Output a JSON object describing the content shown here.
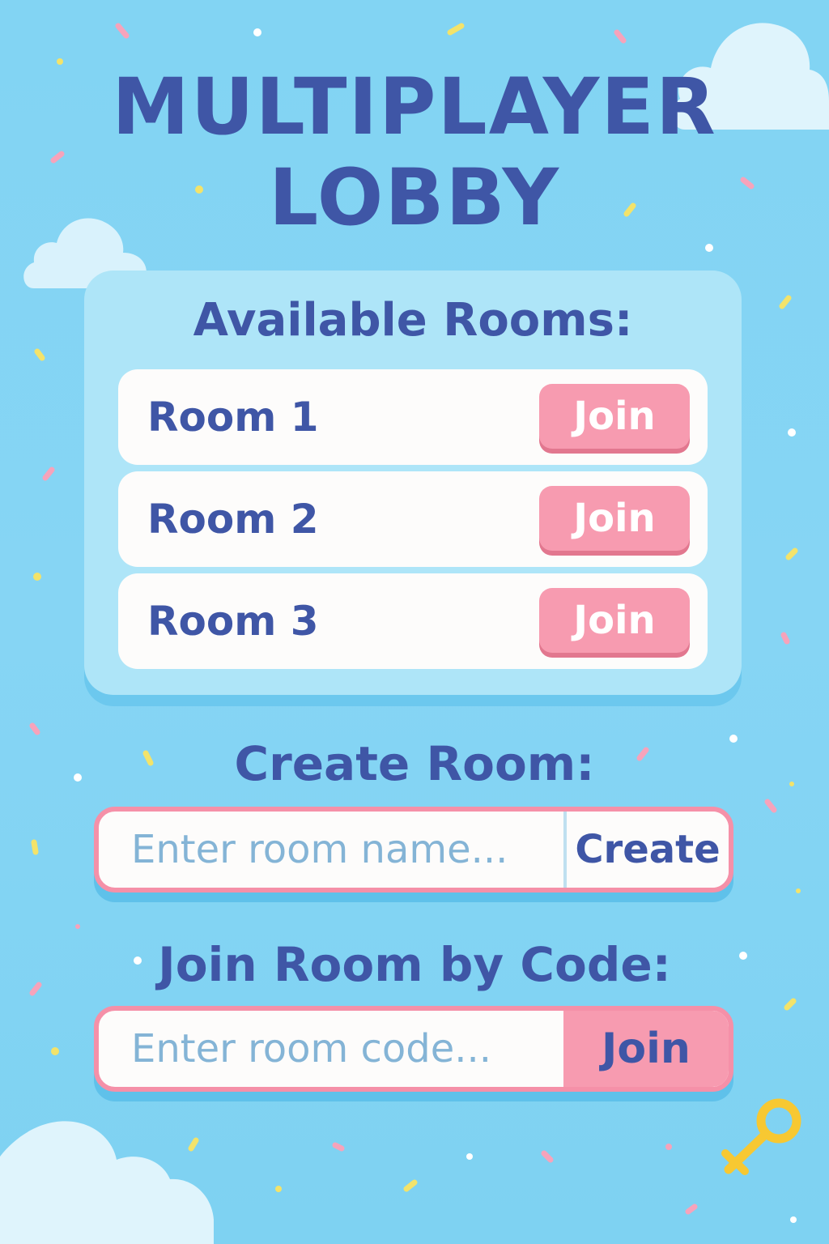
{
  "title": {
    "line1": "MULTIPLAYER",
    "line2": "LOBBY"
  },
  "rooms": {
    "heading": "Available Rooms:",
    "items": [
      {
        "name": "Room 1",
        "action": "Join"
      },
      {
        "name": "Room 2",
        "action": "Join"
      },
      {
        "name": "Room 3",
        "action": "Join"
      }
    ]
  },
  "create": {
    "heading": "Create Room:",
    "placeholder": "Enter room name...",
    "button": "Create"
  },
  "join_code": {
    "heading": "Join Room by Code:",
    "placeholder": "Enter room code...",
    "button": "Join"
  },
  "colors": {
    "background": "#82d4f3",
    "title_text": "#3f56a6",
    "panel": "#aee5f8",
    "row": "#fdfcfb",
    "join_button": "#f79bb0",
    "input_border": "#f590a8",
    "placeholder": "#84b4d6",
    "key": "#f7c832"
  },
  "icons": {
    "decoration_clouds": "cloud-icon",
    "decoration_key": "key-icon",
    "confetti": "confetti-decoration"
  }
}
